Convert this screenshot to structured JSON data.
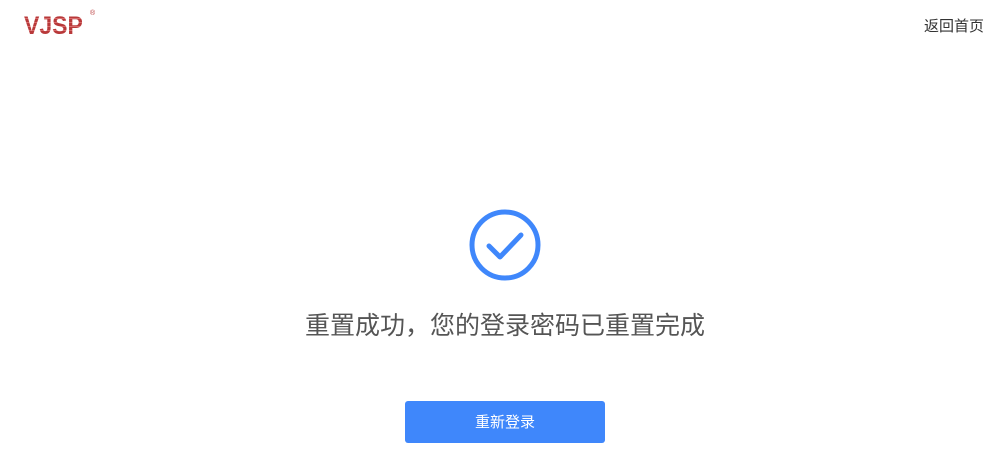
{
  "header": {
    "logo_text": "VJSP",
    "logo_mark": "®",
    "home_link_label": "返回首页"
  },
  "result": {
    "icon": "check-circle-icon",
    "message": "重置成功，您的登录密码已重置完成",
    "relogin_button_label": "重新登录"
  },
  "colors": {
    "brand_red": "#b8393a",
    "accent_blue": "#3f87fb",
    "text_gray": "#555555"
  }
}
